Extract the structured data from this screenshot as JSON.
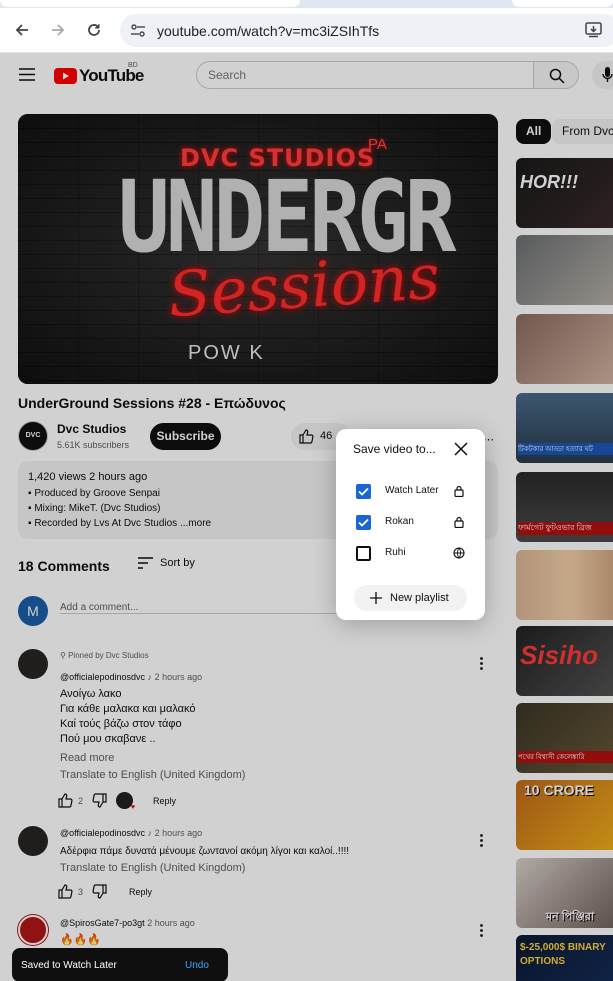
{
  "browser": {
    "url": "youtube.com/watch?v=mc3iZSIhTfs"
  },
  "header": {
    "logo_text": "YouTube",
    "country_code": "BD",
    "search_placeholder": "Search"
  },
  "chips": [
    "All",
    "From Dvc S"
  ],
  "video": {
    "title": "UnderGround Sessions #28 - Επώδυνος",
    "thumb_top": "DVC STUDIOS",
    "thumb_mark": "PA",
    "thumb_main": "UNDERGR",
    "thumb_script": "Sessions",
    "thumb_bottom": "POW K"
  },
  "channel": {
    "name": "Dvc Studios",
    "subscribers": "5.61K subscribers",
    "avatar_text": "DVC",
    "subscribe_label": "Subscribe",
    "likes": "46"
  },
  "description": {
    "stats": "1,420 views  2 hours ago",
    "lines": [
      "Produced by Groove Senpai",
      "Mixing: MikeT. (Dvc Studios)",
      "Recorded by Lvs At Dvc Studios"
    ],
    "more": "...more"
  },
  "comments": {
    "count_label": "18 Comments",
    "sort_label": "Sort by",
    "user_initial": "M",
    "add_placeholder": "Add a comment...",
    "items": [
      {
        "pinned": "Pinned by Dvc Studios",
        "author": "@officialepodinosdvc",
        "time": "2 hours ago",
        "lines": [
          "Ανοίγω λακο",
          "Για κάθε μαλακα και μαλακό",
          "Καί τούς βάζω στον τάφο",
          "Πού μου σκαβανε .."
        ],
        "read_more": "Read more",
        "translate": "Translate to English (United Kingdom)",
        "likes": "2",
        "reply": "Reply"
      },
      {
        "author": "@officialepodinosdvc",
        "time": "2 hours ago",
        "lines": [
          "Αδέρφια πάμε δυνατά μένουμε ζωντανοί ακόμη λίγοι και καλοί..!!!!"
        ],
        "translate": "Translate to English (United Kingdom)",
        "likes": "3",
        "reply": "Reply"
      },
      {
        "author": "@SpirosGate7-po3gt",
        "time": "2 hours ago",
        "lines": [
          "🔥🔥🔥"
        ]
      }
    ]
  },
  "save_dialog": {
    "title": "Save video to...",
    "playlists": [
      {
        "name": "Watch Later",
        "checked": true,
        "privacy_icon": "lock-icon"
      },
      {
        "name": "Rokan",
        "checked": true,
        "privacy_icon": "lock-icon"
      },
      {
        "name": "Ruhi",
        "checked": false,
        "privacy_icon": "globe-icon"
      }
    ],
    "new_playlist_label": "New playlist"
  },
  "toast": {
    "message": "Saved to Watch Later",
    "undo_label": "Undo"
  },
  "sidebar_thumbs": [
    {
      "text": "HOR!!!"
    },
    {
      "text": ""
    },
    {
      "text": ""
    },
    {
      "text": "টিকটকার আড্ডা হত্যার ঘট"
    },
    {
      "text": "ফার্মগেট ফুটওভার ব্রিজ"
    },
    {
      "text": ""
    },
    {
      "text": "Sisiho"
    },
    {
      "text": "পথের বিশ্বাসী কেলেঙ্কারি"
    },
    {
      "text": "10 CRORE"
    },
    {
      "text": "মন পিঞ্জিরা"
    },
    {
      "text": "$-25,000$ BINARY OPTIONS"
    }
  ],
  "colors": {
    "brand_red": "#ff0000",
    "checkbox_blue": "#1a66d2",
    "undo_blue": "#3ea6ff"
  }
}
